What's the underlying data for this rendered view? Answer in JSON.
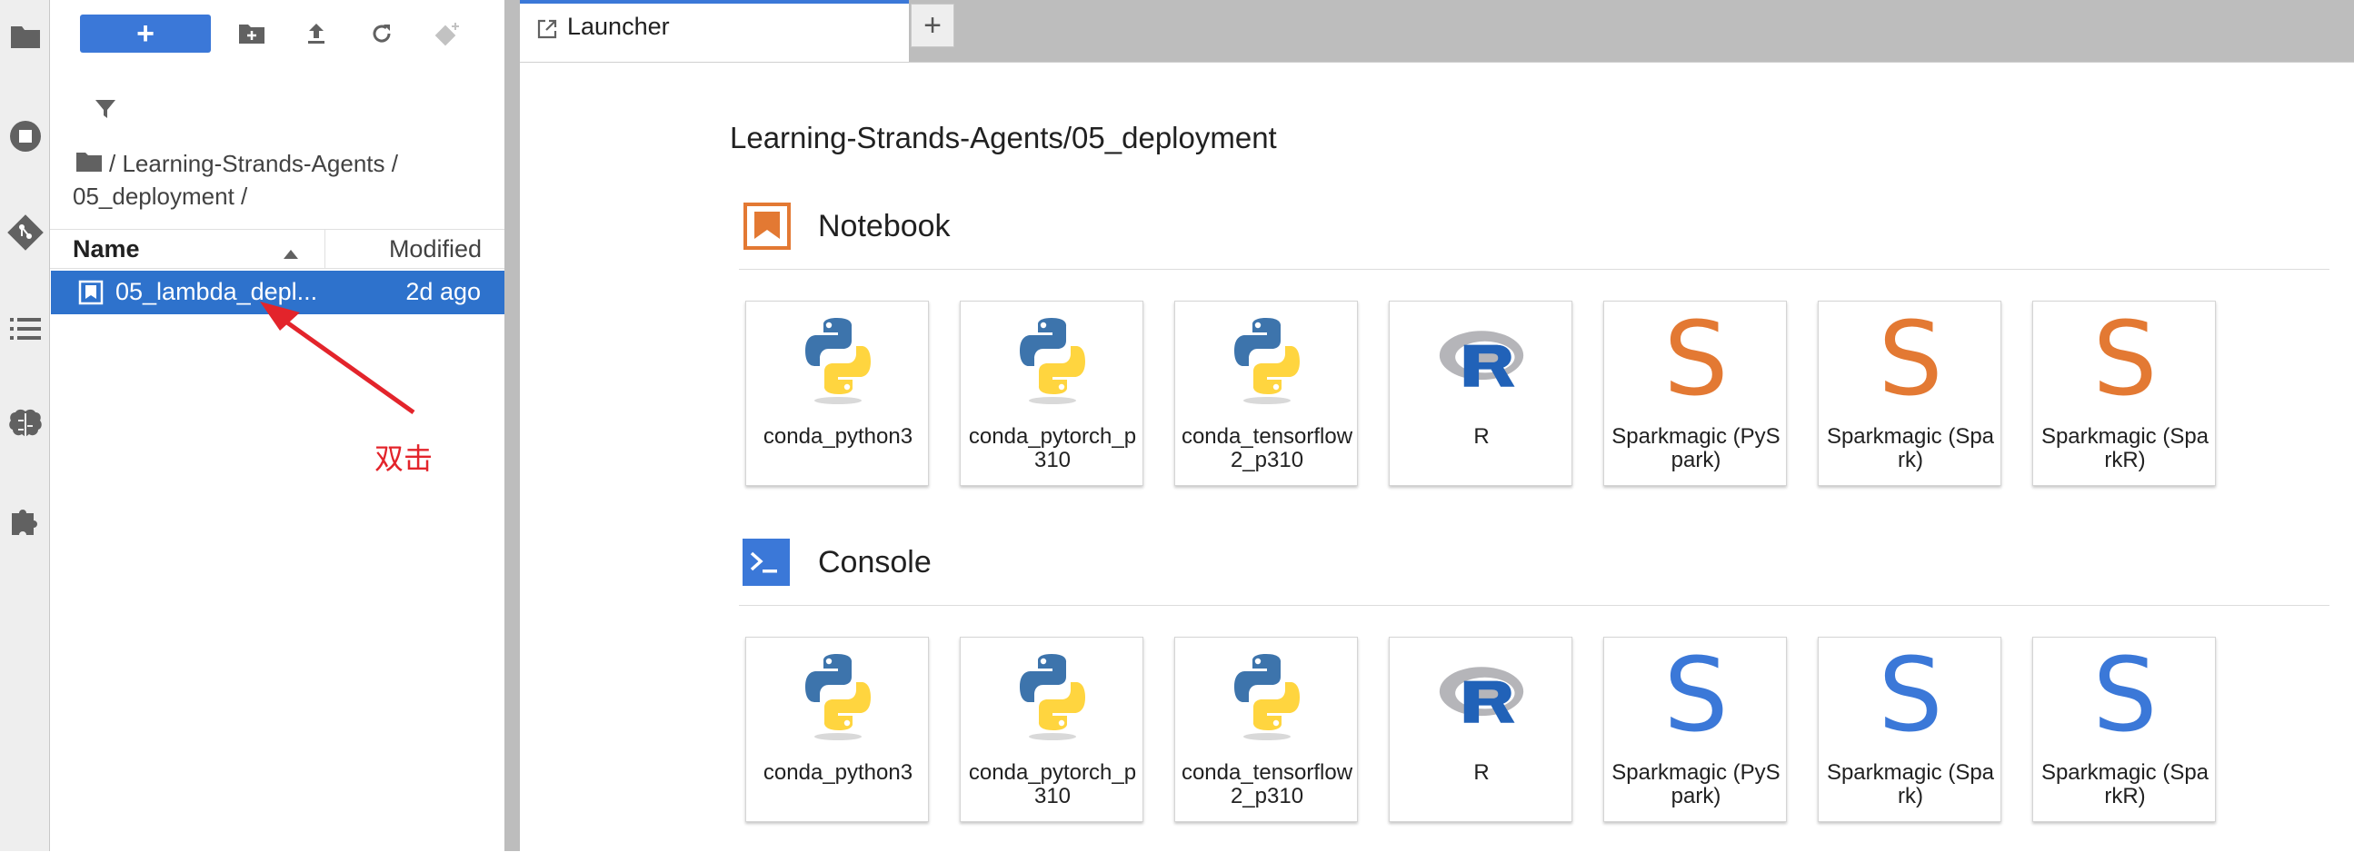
{
  "file_browser": {
    "new_label": "+",
    "breadcrumb": "/ Learning-Strands-Agents / 05_deployment /",
    "columns": {
      "name": "Name",
      "modified": "Modified"
    },
    "files": [
      {
        "name": "05_lambda_depl...",
        "modified": "2d ago"
      }
    ]
  },
  "tabs": [
    {
      "label": "Launcher"
    }
  ],
  "add_tab_label": "+",
  "launcher": {
    "cwd": "Learning-Strands-Agents/05_deployment",
    "notebook": {
      "title": "Notebook",
      "kernels": [
        {
          "label": "conda_python3",
          "icon": "python-logo-icon"
        },
        {
          "label": "conda_pytorch_p310",
          "icon": "python-logo-icon"
        },
        {
          "label": "conda_tensorflow2_p310",
          "icon": "python-logo-icon"
        },
        {
          "label": "R",
          "icon": "r-logo-icon"
        },
        {
          "label": "Sparkmagic (PySpark)",
          "icon": "sparkmagic-s-icon"
        },
        {
          "label": "Sparkmagic (Spark)",
          "icon": "sparkmagic-s-icon"
        },
        {
          "label": "Sparkmagic (SparkR)",
          "icon": "sparkmagic-s-icon"
        }
      ]
    },
    "console": {
      "title": "Console",
      "kernels": [
        {
          "label": "conda_python3",
          "icon": "python-logo-icon"
        },
        {
          "label": "conda_pytorch_p310",
          "icon": "python-logo-icon"
        },
        {
          "label": "conda_tensorflow2_p310",
          "icon": "python-logo-icon"
        },
        {
          "label": "R",
          "icon": "r-logo-icon"
        },
        {
          "label": "Sparkmagic (PySpark)",
          "icon": "sparkmagic-s-icon"
        },
        {
          "label": "Sparkmagic (Spark)",
          "icon": "sparkmagic-s-icon"
        },
        {
          "label": "Sparkmagic (SparkR)",
          "icon": "sparkmagic-s-icon"
        }
      ]
    }
  },
  "annotation": {
    "text": "双击"
  },
  "colors": {
    "accent": "#3b78d8",
    "selection": "#2e72cc",
    "notebook_orange": "#e37933",
    "console_blue": "#3b78d8",
    "annotation_red": "#e3242b"
  }
}
